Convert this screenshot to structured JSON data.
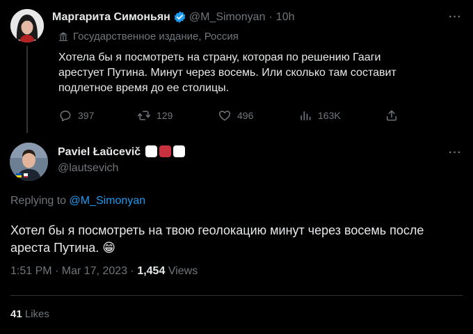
{
  "parent_tweet": {
    "author_name": "Маргарита Симоньян",
    "handle": "@M_Simonyan",
    "separator": "·",
    "time": "10h",
    "label": "Государственное издание, Россия",
    "text_lines": [
      "Хотела бы я посмотреть на страну, которая по решению Гааги",
      "арестует Путина. Минут через восемь. Или сколько там составит",
      "подлетное время до ее столицы."
    ],
    "stats": {
      "replies": "397",
      "retweets": "129",
      "likes": "496",
      "views": "163K"
    },
    "more_label": "···"
  },
  "reply_tweet": {
    "author_name": "Paviel Łaŭcevič",
    "handle": "@lautsevich",
    "more_label": "···",
    "replying_prefix": "Replying to",
    "replying_handle": "@M_Simonyan",
    "text_lines": [
      "Хотел бы я посмотреть на твою геолокацию минут через восемь после",
      "ареста Путина. 😁"
    ],
    "timestamp": "1:51 PM · Mar 17, 2023 ·",
    "views_count": "1,454",
    "views_label": "Views",
    "likes_count": "41",
    "likes_label": "Likes"
  },
  "colors": {
    "background": "#000000",
    "text": "#e7e9ea",
    "muted": "#71767b",
    "link": "#1d9bf0",
    "verified": "#1d9bf0",
    "flag_white": "#ffffff",
    "flag_red": "#c8313e"
  }
}
